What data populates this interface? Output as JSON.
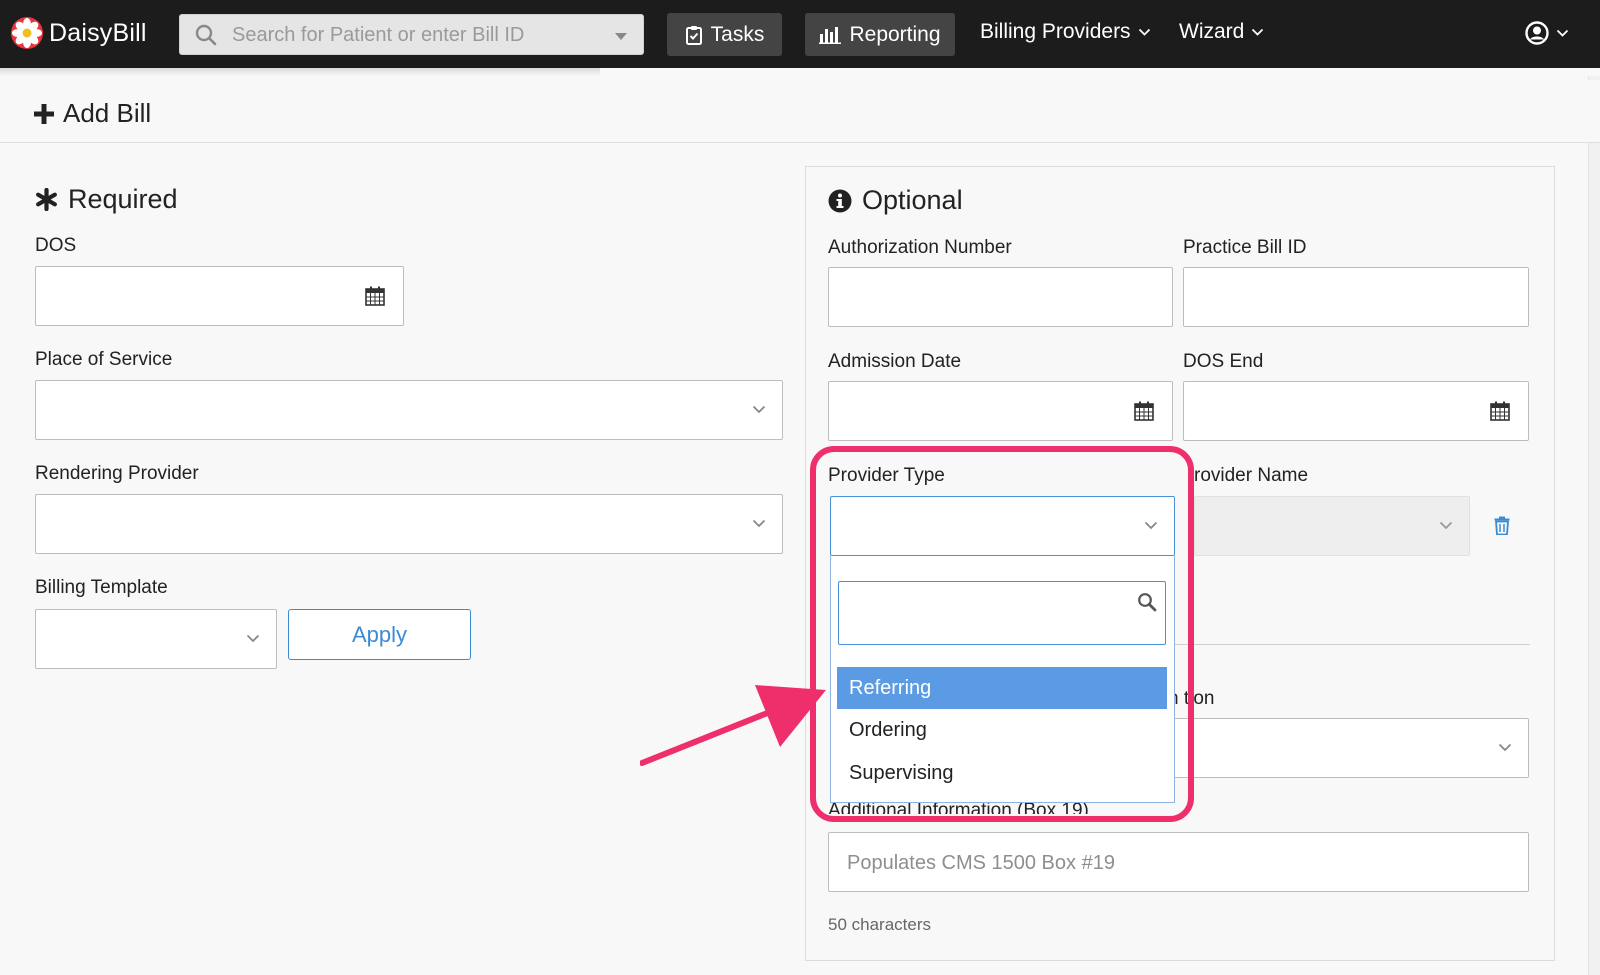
{
  "navbar": {
    "brand": "DaisyBill",
    "search_placeholder": "Search for Patient or enter Bill ID",
    "tasks_label": "Tasks",
    "reporting_label": "Reporting",
    "billing_providers_label": "Billing Providers",
    "wizard_label": "Wizard"
  },
  "page": {
    "title": "Add Bill"
  },
  "required": {
    "title": "Required",
    "dos_label": "DOS",
    "place_of_service_label": "Place of Service",
    "rendering_provider_label": "Rendering Provider",
    "billing_template_label": "Billing Template",
    "apply_label": "Apply"
  },
  "optional": {
    "title": "Optional",
    "authorization_number_label": "Authorization Number",
    "practice_bill_id_label": "Practice Bill ID",
    "admission_date_label": "Admission Date",
    "dos_end_label": "DOS End",
    "provider_type_label": "Provider Type",
    "provider_name_label": "rovider Name",
    "hidden_label_fragment": "n tion",
    "additional_info_label": "Additional Information (Box 19)",
    "additional_info_placeholder": "Populates CMS 1500 Box #19",
    "counter": "50 characters"
  },
  "provider_type_dropdown": {
    "options": [
      "Referring",
      "Ordering",
      "Supervising"
    ],
    "highlighted_index": 0
  },
  "colors": {
    "navbar": "#1c1c1c",
    "accent_blue": "#3c8ad4",
    "highlight_option": "#5b9be3",
    "annotation_pink": "#ee2f6b",
    "logo_red": "#e8353f"
  }
}
